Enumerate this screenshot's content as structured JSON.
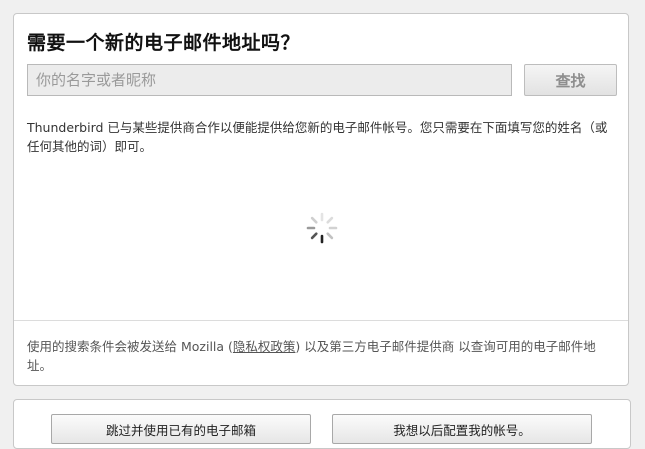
{
  "dialog": {
    "title": "需要一个新的电子邮件地址吗？",
    "search": {
      "placeholder": "你的名字或者昵称",
      "value": "",
      "button_label": "查找"
    },
    "description": "Thunderbird 已与某些提供商合作以便能提供给您新的电子邮件帐号。您只需要在下面填写您的姓名（或任何其他的词）即可。",
    "loading_indicator": "spinner-icon",
    "footer": {
      "text_before": "使用的搜索条件会被发送给 Mozilla (",
      "privacy_link": "隐私权政策",
      "text_after": ") 以及第三方电子邮件提供商 以查询可用的电子邮件地址。"
    }
  },
  "actions": {
    "skip_label": "跳过并使用已有的电子邮箱",
    "later_label": "我想以后配置我的帐号。"
  },
  "colors": {
    "panel_bg": "#ffffff",
    "window_bg": "#f0f0f0",
    "input_bg": "#ececec",
    "button_text_disabled": "#8e8e8e"
  }
}
